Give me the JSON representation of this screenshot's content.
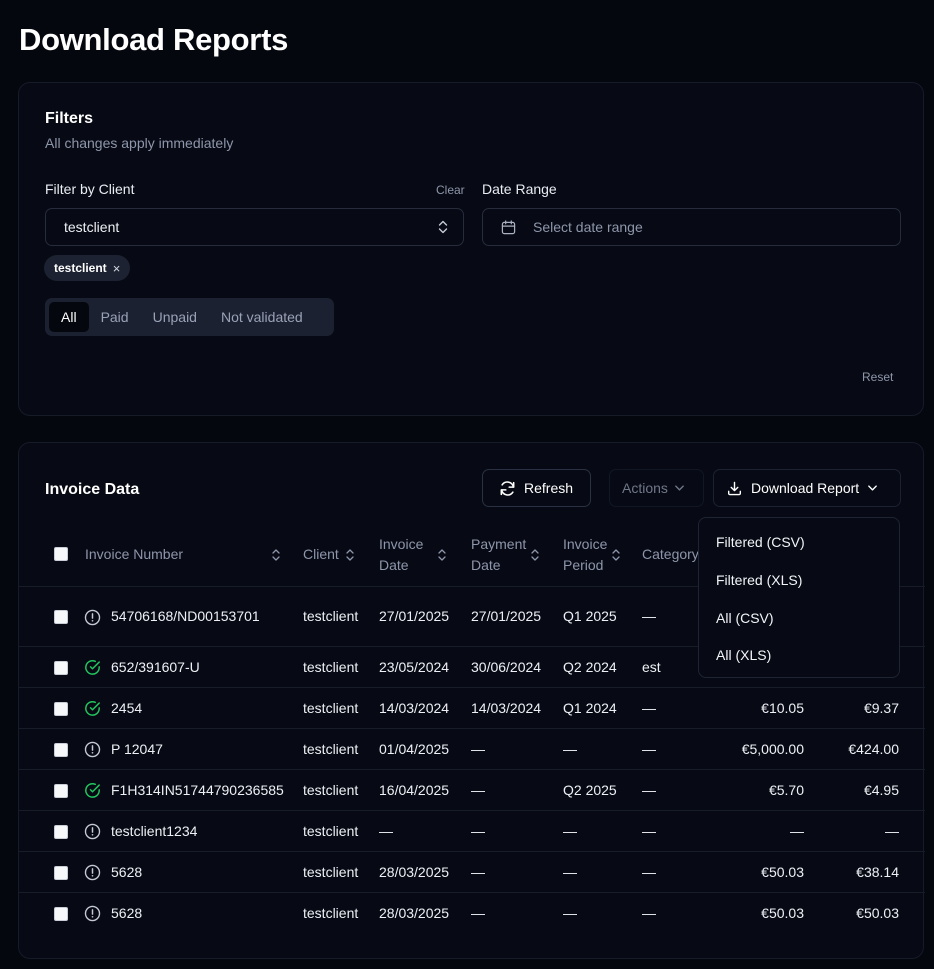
{
  "page": {
    "title": "Download Reports"
  },
  "filters": {
    "title": "Filters",
    "subtitle": "All changes apply immediately",
    "client_label": "Filter by Client",
    "clear_label": "Clear",
    "client_value": "testclient",
    "date_label": "Date Range",
    "date_placeholder": "Select date range",
    "chip_label": "testclient",
    "chip_remove": "×",
    "status_options": [
      "All",
      "Paid",
      "Unpaid",
      "Not validated"
    ],
    "active_status": "All",
    "reset_label": "Reset"
  },
  "invoice": {
    "title": "Invoice Data",
    "refresh_label": "Refresh",
    "actions_label": "Actions",
    "download_label": "Download Report",
    "columns": {
      "invoice_number": "Invoice Number",
      "client": "Client",
      "invoice_date_1": "Invoice",
      "invoice_date_2": "Date",
      "payment_date_1": "Payment",
      "payment_date_2": "Date",
      "invoice_period_1": "Invoice",
      "invoice_period_2": "Period",
      "category": "Category"
    },
    "download_menu": [
      "Filtered (CSV)",
      "Filtered (XLS)",
      "All (CSV)",
      "All (XLS)"
    ],
    "rows": [
      {
        "status": "unvalidated",
        "number": "54706168/ND00153701",
        "client": "testclient",
        "invoice_date": "27/01/2025",
        "payment_date": "27/01/2025",
        "period": "Q1 2025",
        "category": "—",
        "amount": "",
        "amount2": ""
      },
      {
        "status": "validated",
        "number": "652/391607-U",
        "client": "testclient",
        "invoice_date": "23/05/2024",
        "payment_date": "30/06/2024",
        "period": "Q2 2024",
        "category": "est",
        "amount": "",
        "amount2": ""
      },
      {
        "status": "validated",
        "number": "2454",
        "client": "testclient",
        "invoice_date": "14/03/2024",
        "payment_date": "14/03/2024",
        "period": "Q1 2024",
        "category": "—",
        "amount": "€10.05",
        "amount2": "€9.37"
      },
      {
        "status": "unvalidated",
        "number": "P 12047",
        "client": "testclient",
        "invoice_date": "01/04/2025",
        "payment_date": "—",
        "period": "—",
        "category": "—",
        "amount": "€5,000.00",
        "amount2": "€424.00"
      },
      {
        "status": "validated",
        "number": "F1H314IN51744790236585",
        "client": "testclient",
        "invoice_date": "16/04/2025",
        "payment_date": "—",
        "period": "Q2 2025",
        "category": "—",
        "amount": "€5.70",
        "amount2": "€4.95"
      },
      {
        "status": "unvalidated",
        "number": "testclient1234",
        "client": "testclient",
        "invoice_date": "—",
        "payment_date": "—",
        "period": "—",
        "category": "—",
        "amount": "—",
        "amount2": "—"
      },
      {
        "status": "unvalidated",
        "number": "5628",
        "client": "testclient",
        "invoice_date": "28/03/2025",
        "payment_date": "—",
        "period": "—",
        "category": "—",
        "amount": "€50.03",
        "amount2": "€38.14"
      },
      {
        "status": "unvalidated",
        "number": "5628",
        "client": "testclient",
        "invoice_date": "28/03/2025",
        "payment_date": "—",
        "period": "—",
        "category": "—",
        "amount": "€50.03",
        "amount2": "€50.03"
      }
    ]
  },
  "colors": {
    "background": "#05070f",
    "muted_text": "#8e96ab",
    "validated_icon": "#22c55e",
    "unvalidated_icon": "#c4c9d4"
  }
}
